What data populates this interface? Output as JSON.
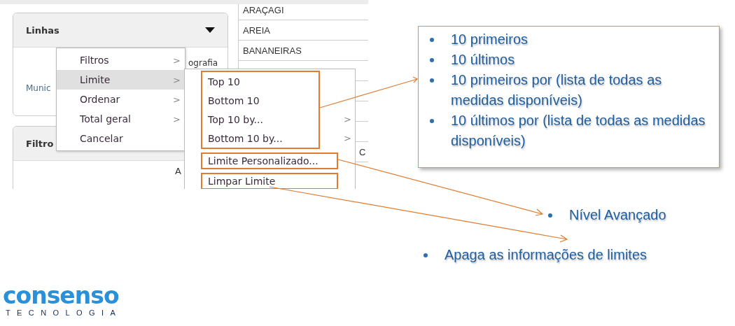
{
  "screenshot": {
    "linhas_panel": {
      "title": "Linhas",
      "row_label": "Munic",
      "column_fragment": "ografia"
    },
    "filtros_panel": {
      "title": "Filtro",
      "cell": "A"
    },
    "table_rows": [
      "ARAÇAGI",
      "AREIA",
      "BANANEIRAS",
      "",
      "",
      "",
      "",
      "C"
    ],
    "context_menu": [
      {
        "label": "Filtros",
        "arrow": ">",
        "selected": false
      },
      {
        "label": "Limite",
        "arrow": ">",
        "selected": true
      },
      {
        "label": "Ordenar",
        "arrow": ">",
        "selected": false
      },
      {
        "label": "Total geral",
        "arrow": ">",
        "selected": false
      },
      {
        "label": "Cancelar",
        "selected": false
      }
    ],
    "submenu_groups": [
      {
        "items": [
          {
            "label": "Top 10"
          },
          {
            "label": "Bottom 10"
          },
          {
            "label": "Top 10 by...",
            "arrow": ">"
          },
          {
            "label": "Bottom 10 by...",
            "arrow": ">"
          }
        ]
      },
      {
        "items": [
          {
            "label": "Limite Personalizado..."
          }
        ]
      },
      {
        "items": [
          {
            "label": "Limpar Limite"
          }
        ]
      }
    ]
  },
  "callouts": {
    "limit_options": [
      "10 primeiros",
      "10 últimos",
      "10 primeiros por  (lista de todas as medidas disponíveis)",
      "10 últimos por  (lista de todas as medidas disponíveis)"
    ],
    "advanced_note": "Nível Avançado",
    "clear_note": "Apaga as informações de limites"
  },
  "logo": {
    "name": "consenso",
    "tagline": "TECNOLOGIA"
  }
}
